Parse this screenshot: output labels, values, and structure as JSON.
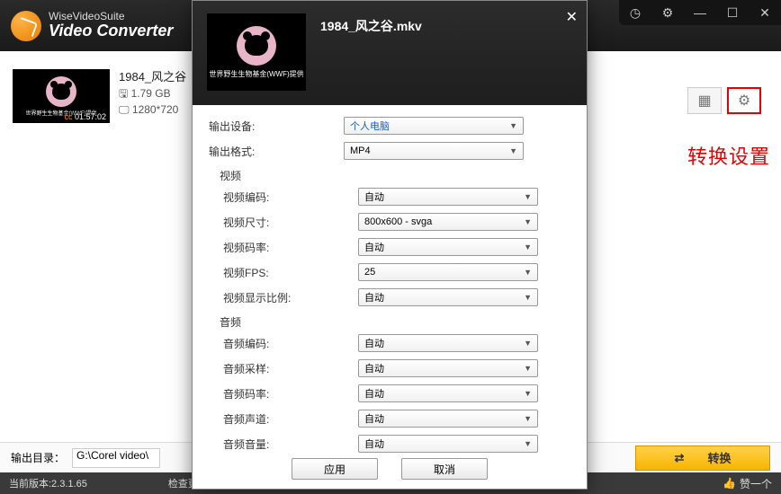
{
  "app": {
    "name": "WiseVideoSuite",
    "product": "Video Converter"
  },
  "window_controls": {
    "clock": "◷",
    "setting": "⚙",
    "min": "—",
    "max": "☐",
    "close": "✕"
  },
  "video_item": {
    "title": "1984_风之谷",
    "size_label": "1.79 GB",
    "dim_label": "1280*720",
    "duration": "01:57:02",
    "thumb_caption": "世界野生生物基金(WWF)提供",
    "cc": "cc"
  },
  "right_tools": {
    "list_icon": "▦",
    "gear_icon": "⚙"
  },
  "annotation": "转换设置",
  "output": {
    "label": "输出目录：",
    "path": "G:\\Corel video\\"
  },
  "convert": {
    "refresh": "⇄",
    "label": "转换"
  },
  "status": {
    "version_label": "当前版本:2.3.1.65",
    "update": "检查更新",
    "like": "赞一个",
    "thumb": "👍"
  },
  "dialog": {
    "close": "✕",
    "filename": "1984_风之谷.mkv",
    "thumb_caption": "世界野生生物基金(WWF)提供",
    "labels": {
      "out_device": "输出设备:",
      "out_format": "输出格式:",
      "video_h": "视频",
      "vcodec": "视频编码:",
      "vsize": "视频尺寸:",
      "vbitrate": "视频码率:",
      "vfps": "视频FPS:",
      "vaspect": "视频显示比例:",
      "audio_h": "音频",
      "acodec": "音频编码:",
      "asample": "音频采样:",
      "abitrate": "音频码率:",
      "achannel": "音频声道:",
      "avolume": "音频音量:"
    },
    "values": {
      "out_device": "个人电脑",
      "out_format": "MP4",
      "vcodec": "自动",
      "vsize": "800x600 - svga",
      "vbitrate": "自动",
      "vfps": "25",
      "vaspect": "自动",
      "acodec": "自动",
      "asample": "自动",
      "abitrate": "自动",
      "achannel": "自动",
      "avolume": "自动"
    },
    "buttons": {
      "apply": "应用",
      "cancel": "取消"
    }
  }
}
